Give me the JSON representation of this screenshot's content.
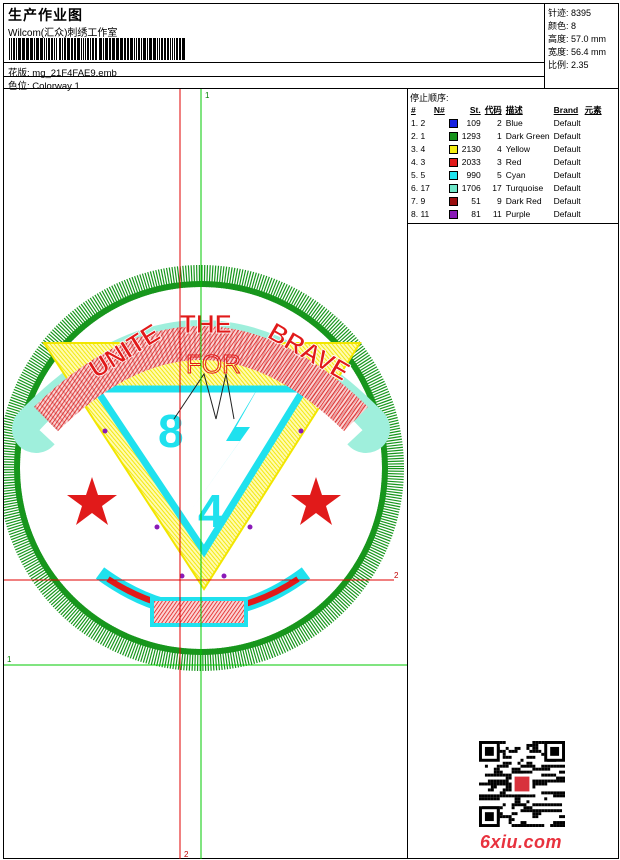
{
  "header": {
    "title": "生产作业图",
    "company": "Wilcom(汇众)刺绣工作室",
    "file_label": "花版:",
    "file_name": "mg_21F4FAE9.emb",
    "colorway_label": "色位:",
    "colorway_name": "Colorway 1"
  },
  "stats": {
    "stitches_label": "针迹:",
    "stitches": "8395",
    "colors_label": "颜色:",
    "colors": "8",
    "height_label": "高度:",
    "height": "57.0 mm",
    "width_label": "宽度:",
    "width": "56.4 mm",
    "scale_label": "比例:",
    "scale": "2.35"
  },
  "sequence": {
    "title": "停止顺序:",
    "columns": [
      "#",
      "N#",
      "",
      "St.",
      "代码",
      "描述",
      "Brand",
      "元素"
    ],
    "rows": [
      {
        "idx": "1. 2",
        "swatch": "#1520e0",
        "st": "109",
        "code": "2",
        "desc": "Blue",
        "brand": "Default"
      },
      {
        "idx": "2. 1",
        "swatch": "#16921c",
        "st": "1293",
        "code": "1",
        "desc": "Dark Green",
        "brand": "Default"
      },
      {
        "idx": "3. 4",
        "swatch": "#f5ee12",
        "st": "2130",
        "code": "4",
        "desc": "Yellow",
        "brand": "Default"
      },
      {
        "idx": "4. 3",
        "swatch": "#e11a1a",
        "st": "2033",
        "code": "3",
        "desc": "Red",
        "brand": "Default"
      },
      {
        "idx": "5. 5",
        "swatch": "#1ee3ef",
        "st": "990",
        "code": "5",
        "desc": "Cyan",
        "brand": "Default"
      },
      {
        "idx": "6. 17",
        "swatch": "#6ee6c8",
        "st": "1706",
        "code": "17",
        "desc": "Turquoise",
        "brand": "Default"
      },
      {
        "idx": "7. 9",
        "swatch": "#9a0e0e",
        "st": "51",
        "code": "9",
        "desc": "Dark Red",
        "brand": "Default"
      },
      {
        "idx": "8. 11",
        "swatch": "#8a1ab8",
        "st": "81",
        "code": "11",
        "desc": "Purple",
        "brand": "Default"
      }
    ]
  },
  "design": {
    "banner_top": [
      "UNITE",
      "THE",
      "BRAVE"
    ],
    "for_text": "FOR",
    "num_top": "8",
    "num_bottom": "4",
    "axis_marker_1": "1",
    "axis_marker_2": "2",
    "colors": {
      "green": "#17961c",
      "yellow": "#f6ee14",
      "red": "#e11a1a",
      "cyan": "#1fe1ee",
      "turquoise": "#72e6c8",
      "purple": "#8a1ab8",
      "axis_red": "#e00000",
      "axis_green": "#00c800"
    }
  },
  "watermark": "6xiu.com"
}
